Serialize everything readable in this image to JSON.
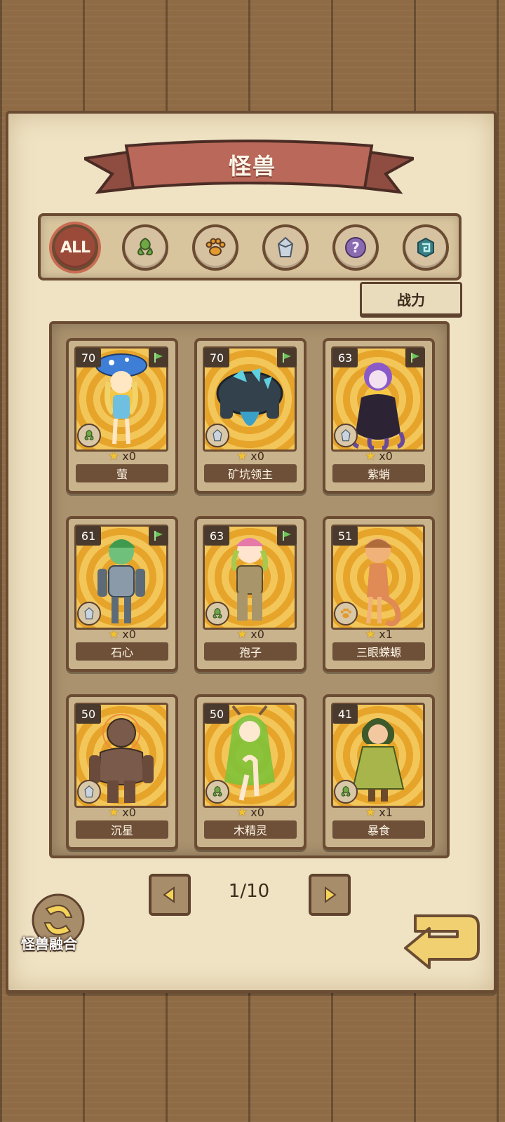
{
  "title": "怪兽",
  "filters": [
    {
      "label": "ALL",
      "icon": "all-icon",
      "active": true
    },
    {
      "label": "",
      "icon": "leaf-icon",
      "active": false
    },
    {
      "label": "",
      "icon": "paw-icon",
      "active": false
    },
    {
      "label": "",
      "icon": "crystal-icon",
      "active": false
    },
    {
      "label": "",
      "icon": "question-icon",
      "active": false
    },
    {
      "label": "",
      "icon": "rune-icon",
      "active": false
    }
  ],
  "sort_label": "战力",
  "cards": [
    {
      "level": "70",
      "count": "x0",
      "name": "萤",
      "type": "leaf-icon",
      "flag": true
    },
    {
      "level": "70",
      "count": "x0",
      "name": "矿坑领主",
      "type": "crystal-icon",
      "flag": true
    },
    {
      "level": "63",
      "count": "x0",
      "name": "紫蛸",
      "type": "crystal-icon",
      "flag": true
    },
    {
      "level": "61",
      "count": "x0",
      "name": "石心",
      "type": "crystal-icon",
      "flag": true
    },
    {
      "level": "63",
      "count": "x0",
      "name": "孢子",
      "type": "leaf-icon",
      "flag": true
    },
    {
      "level": "51",
      "count": "x1",
      "name": "三眼蝾螈",
      "type": "paw-icon",
      "flag": false
    },
    {
      "level": "50",
      "count": "x0",
      "name": "沉星",
      "type": "crystal-icon",
      "flag": false
    },
    {
      "level": "50",
      "count": "x0",
      "name": "木精灵",
      "type": "leaf-icon",
      "flag": false
    },
    {
      "level": "41",
      "count": "x1",
      "name": "暴食",
      "type": "leaf-icon",
      "flag": false
    }
  ],
  "pagination": {
    "text": "1/10"
  },
  "fusion_label": "怪兽融合",
  "colors": {
    "accent": "#9b4a3a",
    "panel": "#efe3c4",
    "wood": "#8f6b45"
  }
}
